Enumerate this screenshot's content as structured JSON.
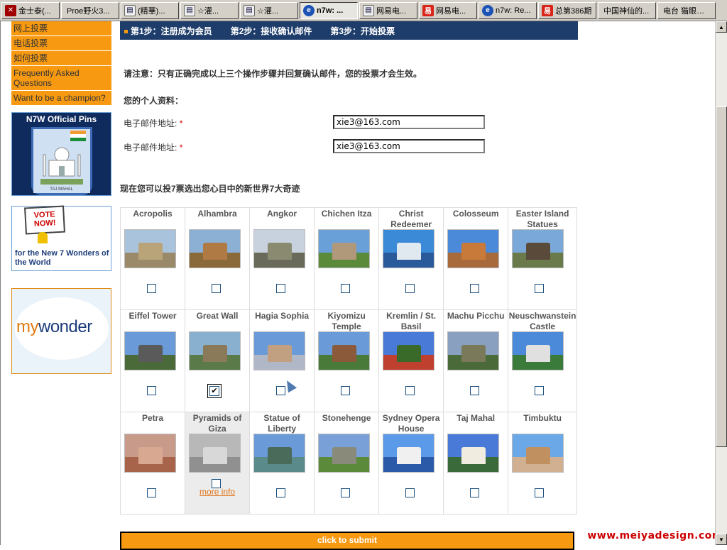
{
  "taskbar": [
    {
      "icon": "app-x-icon",
      "label": "金士泰(..."
    },
    {
      "icon": "none",
      "label": "Proe野火3..."
    },
    {
      "icon": "document-icon",
      "label": "(精華)..."
    },
    {
      "icon": "document-icon",
      "label": "☆灌..."
    },
    {
      "icon": "document-icon",
      "label": "☆灌..."
    },
    {
      "icon": "ie-icon",
      "label": "n7w: ...",
      "active": true
    },
    {
      "icon": "document-icon",
      "label": "网易电..."
    },
    {
      "icon": "netease-icon",
      "label": "网易电..."
    },
    {
      "icon": "ie-icon",
      "label": "n7w: Re..."
    },
    {
      "icon": "netease-icon",
      "label": "总第386期"
    },
    {
      "icon": "none",
      "label": "中国神仙的..."
    },
    {
      "icon": "none",
      "label": "电台 猫眼宽频"
    }
  ],
  "sidebar": {
    "menu": [
      "网上投票",
      "电话投票",
      "如何投票",
      "Frequently Asked Questions",
      "Want to be a champion?"
    ],
    "pins_title": "N7W Official Pins",
    "pins_caption": "TAJ MAHAL",
    "vote_sign": "VOTE NOW!",
    "vote_text": "for the New 7 Wonders of the World",
    "mywonder_my": "my",
    "mywonder_wonder": "wonder"
  },
  "steps": [
    "第1步：注册成为会员",
    "第2步：接收确认邮件",
    "第3步：开始投票"
  ],
  "note": "请注意：只有正确完成以上三个操作步骤并回复确认邮件，您的投票才会生效。",
  "profile_heading": "您的个人资料：",
  "fields": [
    {
      "label": "电子邮件地址:",
      "required": "*",
      "value": "xie3@163.com"
    },
    {
      "label": "电子邮件地址:",
      "required": "*",
      "value": "xie3@163.com"
    }
  ],
  "vote_title": "现在您可以投7票选出您心目中的新世界7大奇迹",
  "wonders": [
    {
      "name": "Acropolis",
      "checked": false
    },
    {
      "name": "Alhambra",
      "checked": false
    },
    {
      "name": "Angkor",
      "checked": false
    },
    {
      "name": "Chichen Itza",
      "checked": false
    },
    {
      "name": "Christ Redeemer",
      "checked": false
    },
    {
      "name": "Colosseum",
      "checked": false
    },
    {
      "name": "Easter Island Statues",
      "checked": false
    },
    {
      "name": "Eiffel Tower",
      "checked": false
    },
    {
      "name": "Great Wall",
      "checked": true
    },
    {
      "name": "Hagia Sophia",
      "checked": false
    },
    {
      "name": "Kiyomizu Temple",
      "checked": false
    },
    {
      "name": "Kremlin / St. Basil",
      "checked": false
    },
    {
      "name": "Machu Picchu",
      "checked": false
    },
    {
      "name": "Neuschwanstein Castle",
      "checked": false
    },
    {
      "name": "Petra",
      "checked": false
    },
    {
      "name": "Pyramids of Giza",
      "checked": false,
      "more_info": "more info"
    },
    {
      "name": "Statue of Liberty",
      "checked": false
    },
    {
      "name": "Stonehenge",
      "checked": false
    },
    {
      "name": "Sydney Opera House",
      "checked": false
    },
    {
      "name": "Taj Mahal",
      "checked": false
    },
    {
      "name": "Timbuktu",
      "checked": false
    }
  ],
  "submit_label": "click to submit",
  "watermark": "www.meiyadesign.com",
  "colors": {
    "orange": "#f79a12",
    "navy": "#1e3d6b",
    "link": "#e0741a"
  }
}
